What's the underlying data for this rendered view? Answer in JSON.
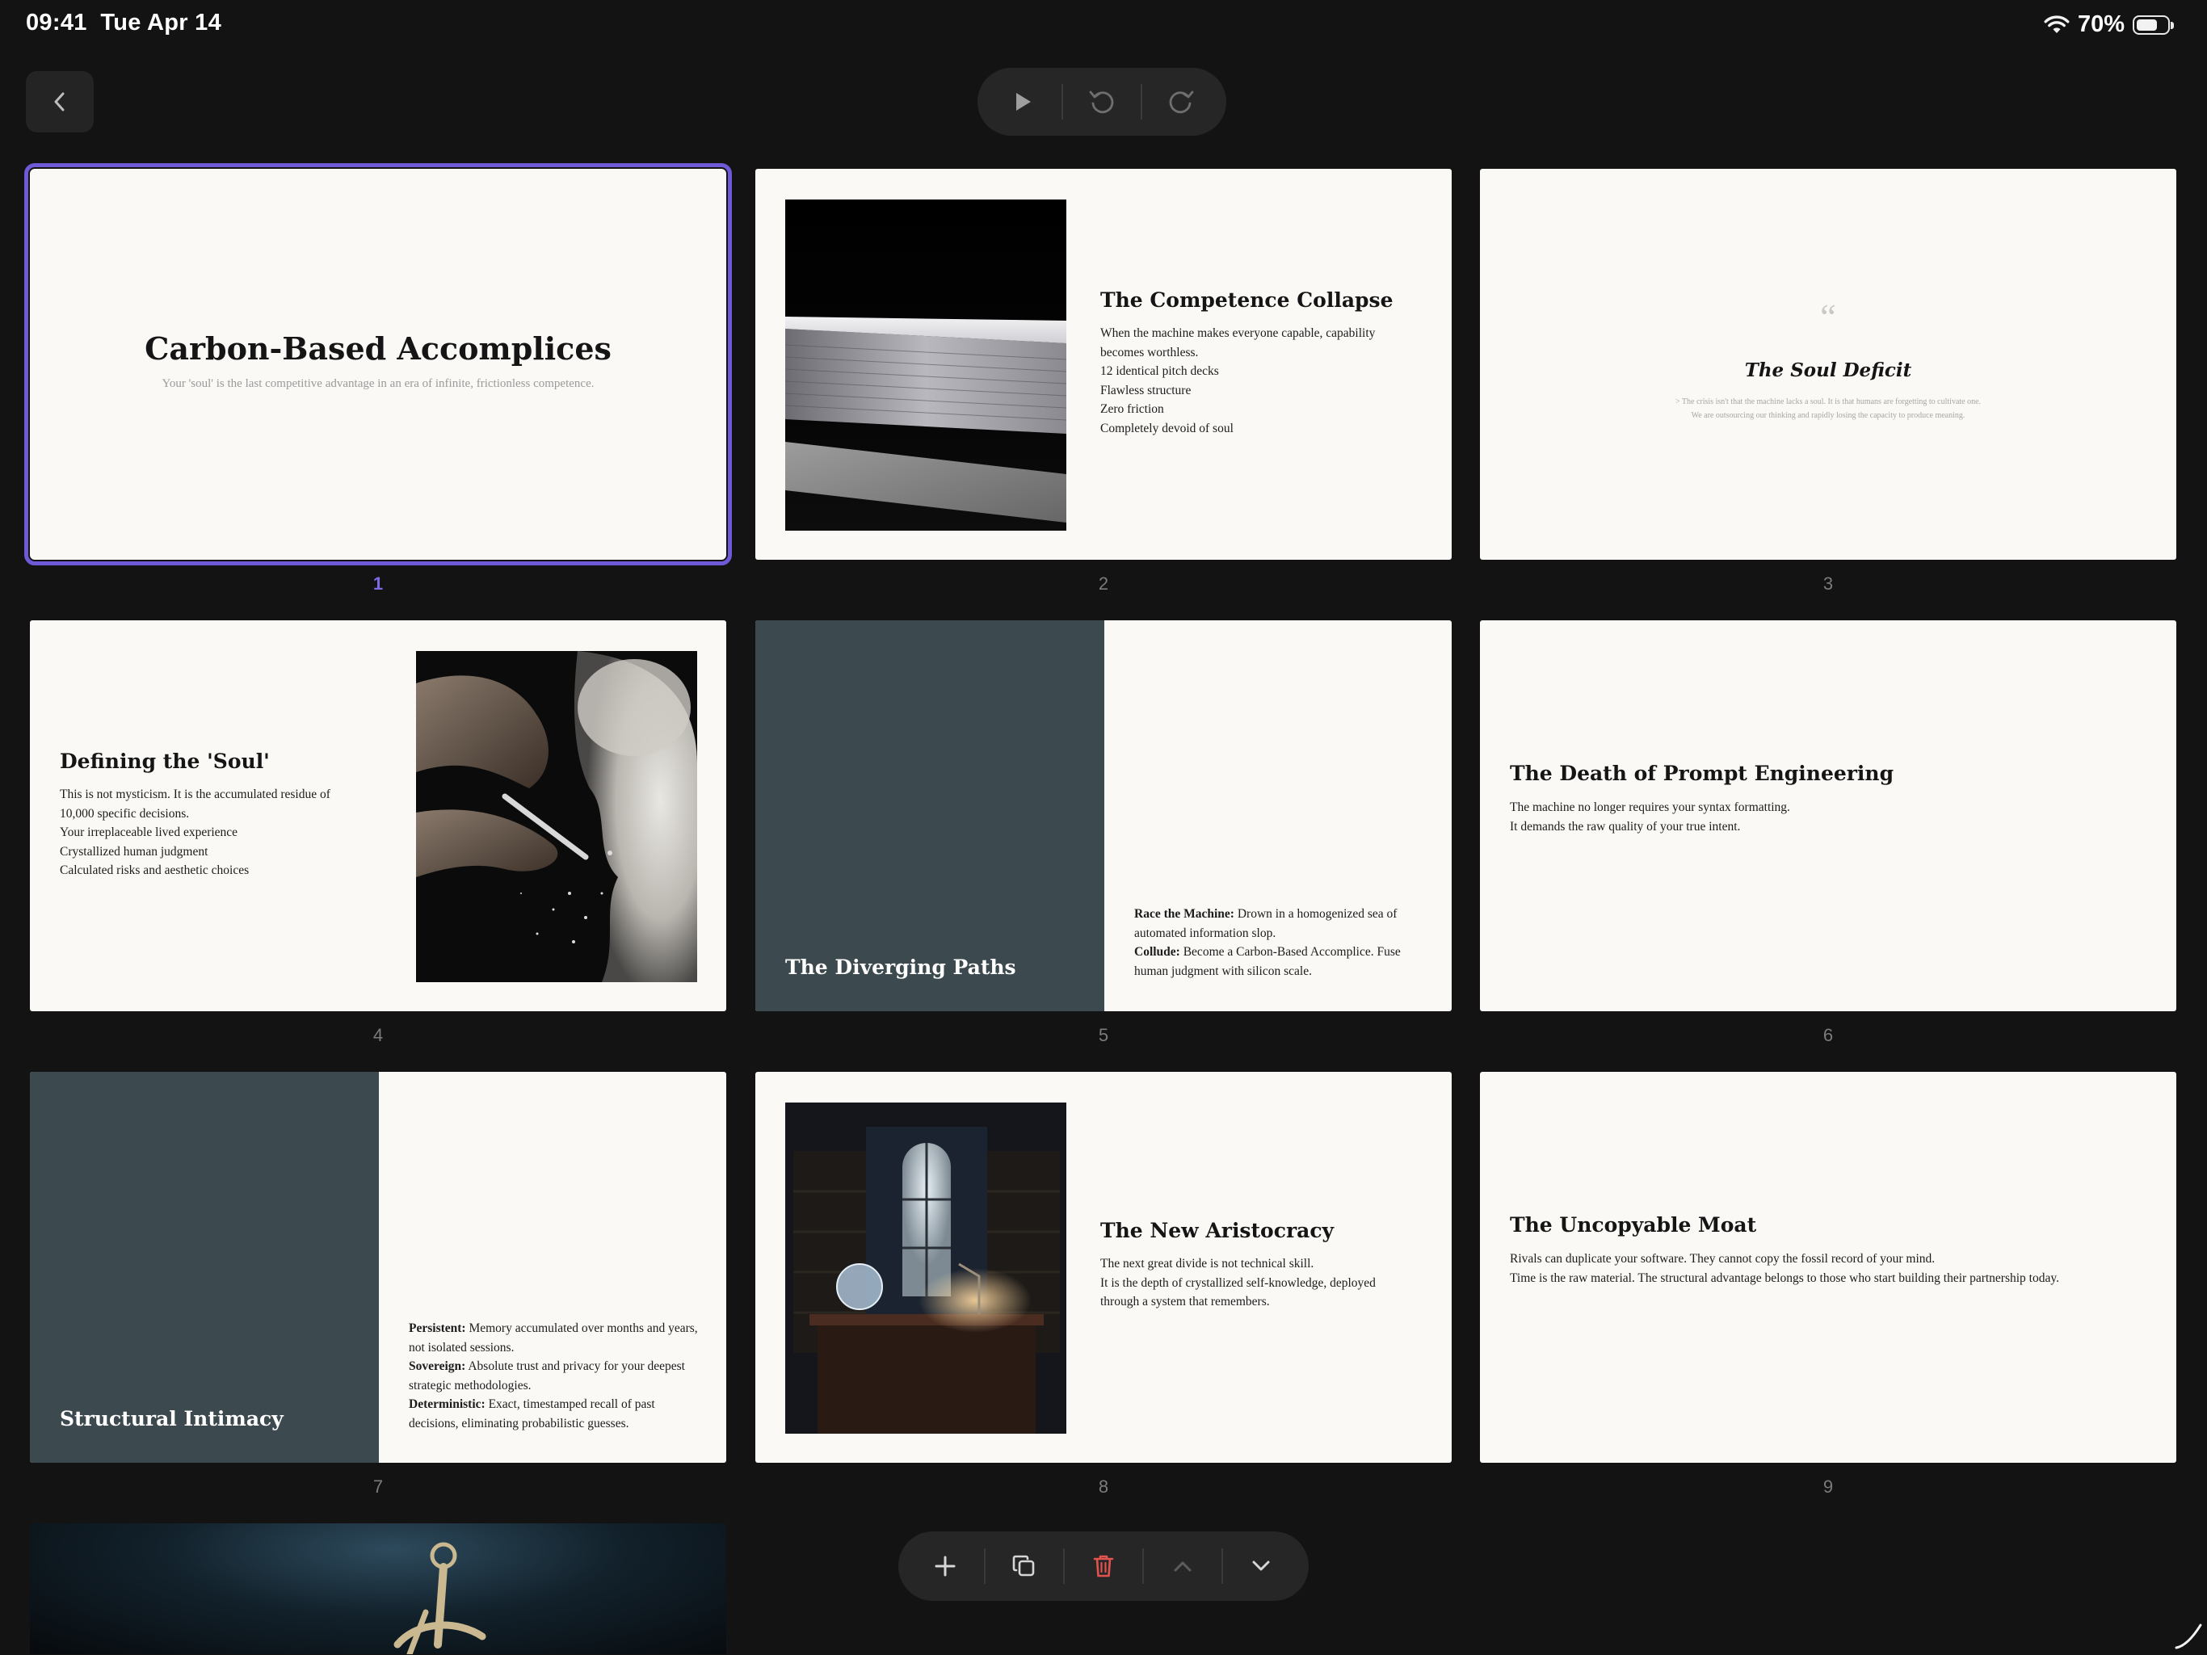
{
  "status": {
    "time": "09:41",
    "date": "Tue Apr 14",
    "battery": "70%",
    "battery_level": 0.7
  },
  "icons": {
    "back": "chevron-left-icon",
    "play": "play-icon",
    "undo": "undo-icon",
    "redo": "redo-icon",
    "add": "plus-icon",
    "duplicate": "duplicate-icon",
    "delete": "trash-icon",
    "move_up": "chevron-up-icon",
    "move_down": "chevron-down-icon",
    "pencil": "pencil-icon"
  },
  "colors": {
    "accent": "#7e6be4",
    "delete": "#e0534f",
    "panel": "#3c4a4f",
    "slide_bg": "#faf9f5"
  },
  "slides": [
    {
      "number": "1",
      "title": "Carbon-Based Accomplices",
      "subtitle": "Your 'soul' is the last competitive advantage in an era of infinite, frictionless competence."
    },
    {
      "number": "2",
      "title": "The Competence Collapse",
      "lines": [
        "When the machine makes everyone capable, capability becomes worthless.",
        "12 identical pitch decks",
        "Flawless structure",
        "Zero friction",
        "Completely devoid of soul"
      ]
    },
    {
      "number": "3",
      "quote_mark": "“",
      "title": "The Soul Deficit",
      "lines": [
        "> The crisis isn't that the machine lacks a soul. It is that humans are forgetting to cultivate one.",
        "We are outsourcing our thinking and rapidly losing the capacity to produce meaning."
      ]
    },
    {
      "number": "4",
      "title": "Defining the 'Soul'",
      "lines": [
        "This is not mysticism. It is the accumulated residue of 10,000 specific decisions.",
        "Your irreplaceable lived experience",
        "Crystallized human judgment",
        "Calculated risks and aesthetic choices"
      ]
    },
    {
      "number": "5",
      "title": "The Diverging Paths",
      "items": [
        {
          "label": "Race the Machine:",
          "text": "Drown in a homogenized sea of automated information slop."
        },
        {
          "label": "Collude:",
          "text": "Become a Carbon-Based Accomplice. Fuse human judgment with silicon scale."
        }
      ]
    },
    {
      "number": "6",
      "title": "The Death of Prompt Engineering",
      "lines": [
        "The machine no longer requires your syntax formatting.",
        "It demands the raw quality of your true intent."
      ]
    },
    {
      "number": "7",
      "title": "Structural Intimacy",
      "items": [
        {
          "label": "Persistent:",
          "text": "Memory accumulated over months and years, not isolated sessions."
        },
        {
          "label": "Sovereign:",
          "text": "Absolute trust and privacy for your deepest strategic methodologies."
        },
        {
          "label": "Deterministic:",
          "text": "Exact, timestamped recall of past decisions, eliminating probabilistic guesses."
        }
      ]
    },
    {
      "number": "8",
      "title": "The New Aristocracy",
      "lines": [
        "The next great divide is not technical skill.",
        "It is the depth of crystallized self-knowledge, deployed through a system that remembers."
      ]
    },
    {
      "number": "9",
      "title": "The Uncopyable Moat",
      "lines": [
        "Rivals can duplicate your software. They cannot copy the fossil record of your mind.",
        "Time is the raw material. The structural advantage belongs to those who start building their partnership today."
      ]
    }
  ]
}
